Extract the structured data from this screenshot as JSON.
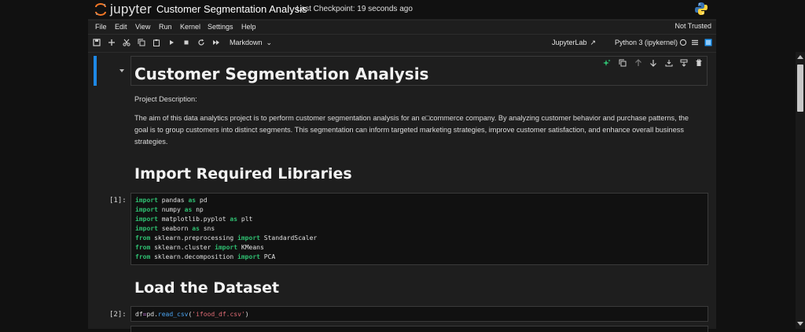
{
  "header": {
    "logo_text": "jupyter",
    "notebook_title": "Customer Segmentation Analysis",
    "checkpoint": "Last Checkpoint: 19 seconds ago"
  },
  "menu": {
    "items": [
      "File",
      "Edit",
      "View",
      "Run",
      "Kernel",
      "Settings",
      "Help"
    ],
    "trust_status": "Not Trusted"
  },
  "toolbar": {
    "cell_type": "Markdown",
    "jupyterlab_label": "JupyterLab",
    "kernel_label": "Python 3 (ipykernel)"
  },
  "cells": {
    "title": "Customer Segmentation Analysis",
    "project_label": "Project Description:",
    "description_lines": [
      "The aim of this data analytics project is to perform customer segmentation analysis for an e□commerce company. By analyzing customer behavior and purchase patterns, the",
      "goal is to group customers into distinct segments. This segmentation can inform targeted marketing strategies, improve customer satisfaction, and enhance overall business",
      "strategies."
    ],
    "import_heading": "Import Required Libraries",
    "import_prompt": "[1]:",
    "load_heading": "Load the Dataset",
    "load_prompt": "[2]:"
  }
}
